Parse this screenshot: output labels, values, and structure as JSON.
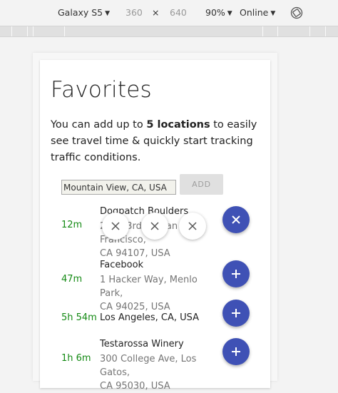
{
  "devtools": {
    "device": "Galaxy S5",
    "width": "360",
    "times": "×",
    "height": "640",
    "zoom": "90%",
    "network": "Online",
    "rotate_icon": "rotate-screen-icon"
  },
  "page": {
    "title": "Favorites",
    "intro_before": "You can add up to ",
    "intro_bold": "5 locations",
    "intro_after": " to easily see travel time & quickly start tracking traffic conditions.",
    "input_value": "Mountain View, CA, USA",
    "add_label": "ADD"
  },
  "favorites": [
    {
      "time": "12m",
      "name": "Dogpatch Boulders",
      "address_line1": "2573 3rd St, San Francisco,",
      "address_line2": "CA 94107, USA",
      "action": "close-icon"
    },
    {
      "time": "47m",
      "name": "Facebook",
      "address_line1": "1 Hacker Way, Menlo Park,",
      "address_line2": "CA 94025, USA",
      "action": "plus-icon"
    },
    {
      "time": "5h 54m",
      "name": "Los Angeles, CA, USA",
      "address_line1": "",
      "address_line2": "",
      "action": "plus-icon"
    },
    {
      "time": "1h 6m",
      "name": "Testarossa Winery",
      "address_line1": "300 College Ave, Los Gatos,",
      "address_line2": "CA 95030, USA",
      "action": "plus-icon"
    }
  ],
  "colors": {
    "accent": "#3f51b5",
    "time_green": "#148a14",
    "address_gray": "#757575"
  }
}
